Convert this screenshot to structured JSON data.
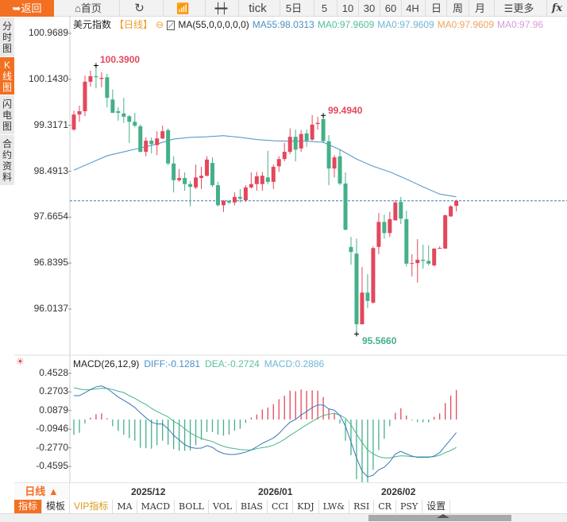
{
  "toolbar": {
    "back": "返回",
    "home": "首页",
    "refresh_icon": "refresh-icon",
    "trend_icon": "trend-chart-icon",
    "candle_icon": "candlestick-icon",
    "tick": "tick",
    "d5": "5日",
    "m5": "5",
    "m10": "10",
    "m30": "30",
    "m60": "60",
    "h4": "4H",
    "day": "日",
    "week": "周",
    "month": "月",
    "more": "更多",
    "fx": "fx"
  },
  "sidebar": {
    "items": [
      {
        "label": "分时图"
      },
      {
        "label": "K线图",
        "active": true
      },
      {
        "label": "闪电图"
      },
      {
        "label": "合约资料"
      }
    ]
  },
  "legend": {
    "symbol": "美元指数",
    "period": "【日线】",
    "ma_params": "MA(55,0,0,0,0,0)",
    "ma55": "MA55:98.0313",
    "ma0_1": "MA0:97.9609",
    "ma0_2": "MA0:97.9609",
    "ma0_3": "MA0:97.9609",
    "ma0_4": "MA0:97.96"
  },
  "macd_legend": {
    "params": "MACD(26,12,9)",
    "diff": "DIFF:-0.1281",
    "dea": "DEA:-0.2724",
    "macd": "MACD:0.2886"
  },
  "colors": {
    "accent": "#f36f21",
    "up": "#e4475c",
    "down": "#45b088",
    "ma55": "#4a8fc4",
    "diff": "#3a78b5",
    "dea": "#48b48e"
  },
  "annotations": {
    "high1": "100.3900",
    "high2": "99.4940",
    "low": "95.5660"
  },
  "date_row": {
    "period": "日线 ▲",
    "dates": [
      "2025/12",
      "2026/01",
      "2026/02"
    ]
  },
  "tabs": [
    "指标",
    "模板",
    "VIP指标",
    "MA",
    "MACD",
    "BOLL",
    "VOL",
    "BIAS",
    "CCI",
    "KDJ",
    "LW&",
    "RSI",
    "CR",
    "PSY",
    "设置"
  ],
  "chart_data": [
    {
      "type": "candlestick",
      "title": "美元指数",
      "yticks": [
        "100.9689",
        "100.1430",
        "99.3171",
        "98.4913",
        "97.6654",
        "96.8395",
        "96.0137"
      ],
      "ylim": [
        95.45,
        101.2
      ],
      "xticks": [
        "2025/12",
        "2026/01",
        "2026/02"
      ],
      "last_price_line": 97.96,
      "ohlc": [
        [
          99.24,
          99.51,
          99.58,
          99.22
        ],
        [
          99.51,
          99.57,
          99.67,
          99.38
        ],
        [
          99.57,
          100.1,
          100.21,
          99.48
        ],
        [
          100.1,
          100.2,
          100.3,
          100.01
        ],
        [
          100.2,
          100.18,
          100.39,
          99.98
        ],
        [
          100.15,
          100.17,
          100.27,
          100.0
        ],
        [
          100.18,
          99.81,
          100.24,
          99.64
        ],
        [
          99.78,
          99.54,
          99.96,
          99.54
        ],
        [
          99.57,
          99.54,
          99.64,
          99.4
        ],
        [
          99.53,
          99.47,
          99.81,
          99.36
        ],
        [
          99.48,
          99.38,
          99.5,
          99.0
        ],
        [
          99.38,
          99.31,
          99.54,
          99.28
        ],
        [
          99.3,
          98.84,
          99.33,
          98.83
        ],
        [
          98.84,
          99.04,
          99.1,
          98.76
        ],
        [
          99.04,
          98.98,
          99.1,
          98.81
        ],
        [
          98.96,
          99.08,
          99.21,
          98.78
        ],
        [
          99.08,
          99.21,
          99.31,
          99.07
        ],
        [
          99.23,
          98.63,
          99.26,
          98.6
        ],
        [
          98.63,
          98.33,
          98.76,
          98.11
        ],
        [
          98.33,
          98.37,
          98.53,
          98.3
        ],
        [
          98.37,
          98.26,
          98.47,
          98.14
        ],
        [
          98.26,
          98.21,
          98.31,
          97.86
        ],
        [
          98.2,
          98.38,
          98.61,
          98.17
        ],
        [
          98.37,
          98.41,
          98.57,
          98.17
        ],
        [
          98.41,
          98.7,
          98.76,
          98.4
        ],
        [
          98.64,
          98.24,
          98.74,
          98.21
        ],
        [
          98.24,
          97.88,
          98.3,
          97.86
        ],
        [
          97.88,
          97.96,
          97.97,
          97.76
        ],
        [
          97.96,
          97.93,
          97.97,
          97.9
        ],
        [
          97.93,
          98.03,
          98.11,
          97.88
        ],
        [
          98.03,
          98.0,
          98.17,
          97.93
        ],
        [
          97.97,
          98.2,
          98.24,
          97.94
        ],
        [
          98.2,
          98.26,
          98.47,
          98.18
        ],
        [
          98.26,
          98.4,
          98.48,
          98.14
        ],
        [
          98.26,
          98.41,
          98.48,
          98.14
        ],
        [
          98.38,
          98.3,
          98.86,
          98.26
        ],
        [
          98.3,
          98.57,
          98.61,
          98.17
        ],
        [
          98.58,
          98.71,
          98.76,
          98.48
        ],
        [
          98.71,
          98.84,
          99.0,
          98.67
        ],
        [
          98.84,
          99.11,
          99.26,
          98.8
        ],
        [
          99.11,
          98.88,
          99.24,
          98.67
        ],
        [
          98.9,
          99.16,
          99.23,
          98.84
        ],
        [
          99.17,
          99.04,
          99.24,
          98.93
        ],
        [
          99.06,
          99.33,
          99.5,
          99.04
        ],
        [
          99.34,
          99.36,
          99.47,
          99.24
        ],
        [
          99.43,
          99.03,
          99.494,
          99.0
        ],
        [
          99.03,
          98.54,
          99.14,
          98.24
        ],
        [
          98.54,
          98.74,
          98.78,
          98.38
        ],
        [
          98.76,
          98.27,
          98.88,
          98.24
        ],
        [
          98.27,
          97.44,
          98.47,
          97.43
        ],
        [
          97.13,
          97.04,
          97.31,
          96.81
        ],
        [
          97.01,
          95.74,
          97.28,
          95.566
        ],
        [
          95.74,
          96.31,
          96.77,
          95.74
        ],
        [
          96.31,
          96.16,
          96.64,
          96.03
        ],
        [
          96.13,
          97.11,
          97.14,
          96.11
        ],
        [
          97.13,
          97.58,
          97.74,
          97.0
        ],
        [
          97.58,
          97.38,
          97.71,
          97.28
        ],
        [
          97.38,
          97.63,
          97.76,
          97.31
        ],
        [
          97.61,
          97.93,
          97.97,
          97.6
        ],
        [
          97.94,
          97.64,
          98.03,
          97.54
        ],
        [
          97.63,
          96.83,
          97.78,
          96.78
        ],
        [
          96.83,
          96.84,
          97.0,
          96.6
        ],
        [
          96.84,
          96.9,
          97.27,
          96.49
        ],
        [
          96.9,
          96.88,
          97.17,
          96.74
        ],
        [
          96.88,
          96.83,
          97.16,
          96.8
        ],
        [
          96.8,
          97.1,
          97.11,
          96.78
        ],
        [
          97.1,
          97.11,
          97.14,
          97.1
        ],
        [
          97.1,
          97.7,
          97.71,
          97.1
        ],
        [
          97.68,
          97.86,
          97.88,
          97.67
        ],
        [
          97.87,
          97.96,
          97.98,
          97.77
        ]
      ],
      "ma55": {
        "name": "MA55",
        "index": [
          0,
          3,
          6,
          9,
          12,
          15,
          18,
          21,
          24,
          27,
          30,
          33,
          36,
          39,
          42,
          45,
          48,
          51,
          54,
          57,
          60,
          63,
          66,
          69
        ],
        "values": [
          98.51,
          98.64,
          98.77,
          98.84,
          98.91,
          98.98,
          99.07,
          99.1,
          99.11,
          99.13,
          99.1,
          99.06,
          99.04,
          99.03,
          99.03,
          99.01,
          98.88,
          98.71,
          98.58,
          98.48,
          98.35,
          98.21,
          98.08,
          98.03
        ]
      }
    },
    {
      "type": "macd",
      "yticks": [
        "0.4528",
        "0.2703",
        "0.0879",
        "-0.0946",
        "-0.2770",
        "-0.4595"
      ],
      "ylim": [
        -0.55,
        0.5
      ],
      "diff": [
        0.233,
        0.233,
        0.262,
        0.293,
        0.319,
        0.329,
        0.303,
        0.262,
        0.22,
        0.188,
        0.155,
        0.117,
        0.065,
        0.018,
        -0.026,
        -0.044,
        -0.044,
        -0.091,
        -0.155,
        -0.199,
        -0.246,
        -0.272,
        -0.282,
        -0.28,
        -0.256,
        -0.272,
        -0.311,
        -0.332,
        -0.342,
        -0.342,
        -0.332,
        -0.319,
        -0.298,
        -0.267,
        -0.233,
        -0.207,
        -0.181,
        -0.137,
        -0.078,
        -0.026,
        0.0,
        0.044,
        0.078,
        0.117,
        0.142,
        0.142,
        0.104,
        0.091,
        0.039,
        -0.065,
        -0.22,
        -0.376,
        -0.505,
        -0.562,
        -0.544,
        -0.492,
        -0.466,
        -0.414,
        -0.337,
        -0.311,
        -0.337,
        -0.357,
        -0.37,
        -0.37,
        -0.37,
        -0.357,
        -0.324,
        -0.259,
        -0.194,
        -0.128
      ],
      "dea": [
        0.311,
        0.298,
        0.29,
        0.293,
        0.298,
        0.306,
        0.303,
        0.293,
        0.277,
        0.264,
        0.233,
        0.207,
        0.174,
        0.148,
        0.109,
        0.078,
        0.052,
        0.026,
        -0.018,
        -0.047,
        -0.091,
        -0.13,
        -0.161,
        -0.186,
        -0.202,
        -0.215,
        -0.241,
        -0.262,
        -0.277,
        -0.285,
        -0.293,
        -0.298,
        -0.298,
        -0.285,
        -0.275,
        -0.267,
        -0.251,
        -0.225,
        -0.194,
        -0.155,
        -0.122,
        -0.085,
        -0.052,
        -0.018,
        0.013,
        0.039,
        0.052,
        0.06,
        0.044,
        0.013,
        -0.052,
        -0.142,
        -0.225,
        -0.298,
        -0.337,
        -0.363,
        -0.376,
        -0.376,
        -0.363,
        -0.355,
        -0.357,
        -0.363,
        -0.365,
        -0.365,
        -0.365,
        -0.363,
        -0.35,
        -0.324,
        -0.303,
        -0.272
      ],
      "macd": [
        -0.15,
        -0.13,
        -0.039,
        0.018,
        0.052,
        0.06,
        0.013,
        -0.065,
        -0.111,
        -0.148,
        -0.181,
        -0.207,
        -0.277,
        -0.28,
        -0.285,
        -0.251,
        -0.207,
        -0.246,
        -0.29,
        -0.306,
        -0.306,
        -0.303,
        -0.251,
        -0.199,
        -0.122,
        -0.122,
        -0.148,
        -0.158,
        -0.148,
        -0.109,
        -0.091,
        -0.034,
        0.018,
        0.049,
        0.098,
        0.117,
        0.15,
        0.199,
        0.233,
        0.282,
        0.277,
        0.293,
        0.28,
        0.285,
        0.282,
        0.22,
        0.104,
        0.065,
        -0.039,
        -0.207,
        -0.35,
        -0.583,
        -0.622,
        -0.622,
        -0.492,
        -0.298,
        -0.189,
        -0.065,
        0.065,
        0.109,
        0.039,
        -0.008,
        -0.026,
        -0.026,
        -0.026,
        0.026,
        0.06,
        0.161,
        0.233,
        0.2886
      ]
    }
  ]
}
